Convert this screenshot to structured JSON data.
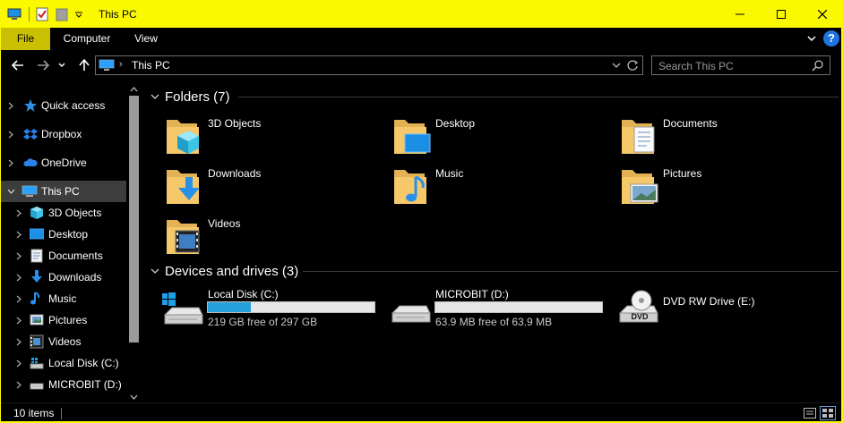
{
  "window": {
    "title": "This PC"
  },
  "ribbon": {
    "tabs": [
      {
        "label": "File"
      },
      {
        "label": "Computer"
      },
      {
        "label": "View"
      }
    ],
    "help": "?"
  },
  "address": {
    "crumb": "This PC",
    "search_placeholder": "Search This PC"
  },
  "sidebar": {
    "items": [
      {
        "label": "Quick access",
        "icon": "star-icon"
      },
      {
        "label": "Dropbox",
        "icon": "dropbox-icon"
      },
      {
        "label": "OneDrive",
        "icon": "cloud-icon"
      },
      {
        "label": "This PC",
        "icon": "computer-icon",
        "selected": true
      },
      {
        "label": "3D Objects",
        "icon": "cube-icon"
      },
      {
        "label": "Desktop",
        "icon": "desktop-icon"
      },
      {
        "label": "Documents",
        "icon": "document-icon"
      },
      {
        "label": "Downloads",
        "icon": "download-icon"
      },
      {
        "label": "Music",
        "icon": "music-icon"
      },
      {
        "label": "Pictures",
        "icon": "picture-icon"
      },
      {
        "label": "Videos",
        "icon": "video-icon"
      },
      {
        "label": "Local Disk (C:)",
        "icon": "drive-icon"
      },
      {
        "label": "MICROBIT (D:)",
        "icon": "usb-drive-icon"
      }
    ]
  },
  "content": {
    "folders_header": "Folders (7)",
    "folders": [
      {
        "name": "3D Objects",
        "overlay": "cube"
      },
      {
        "name": "Desktop",
        "overlay": "desktop"
      },
      {
        "name": "Documents",
        "overlay": "document"
      },
      {
        "name": "Downloads",
        "overlay": "download"
      },
      {
        "name": "Music",
        "overlay": "music"
      },
      {
        "name": "Pictures",
        "overlay": "picture"
      },
      {
        "name": "Videos",
        "overlay": "video"
      }
    ],
    "drives_header": "Devices and drives (3)",
    "drives": [
      {
        "name": "Local Disk (C:)",
        "free_text": "219 GB free of 297 GB",
        "used_fraction": 0.26
      },
      {
        "name": "MICROBIT (D:)",
        "free_text": "63.9 MB free of 63.9 MB",
        "used_fraction": 0.0
      },
      {
        "name": "DVD RW Drive (E:)",
        "disc_label": "DVD"
      }
    ]
  },
  "status": {
    "count": "10 items"
  },
  "colors": {
    "titlebar": "#fbf900",
    "accent": "#26a0da",
    "folder": "#f5c86a"
  }
}
